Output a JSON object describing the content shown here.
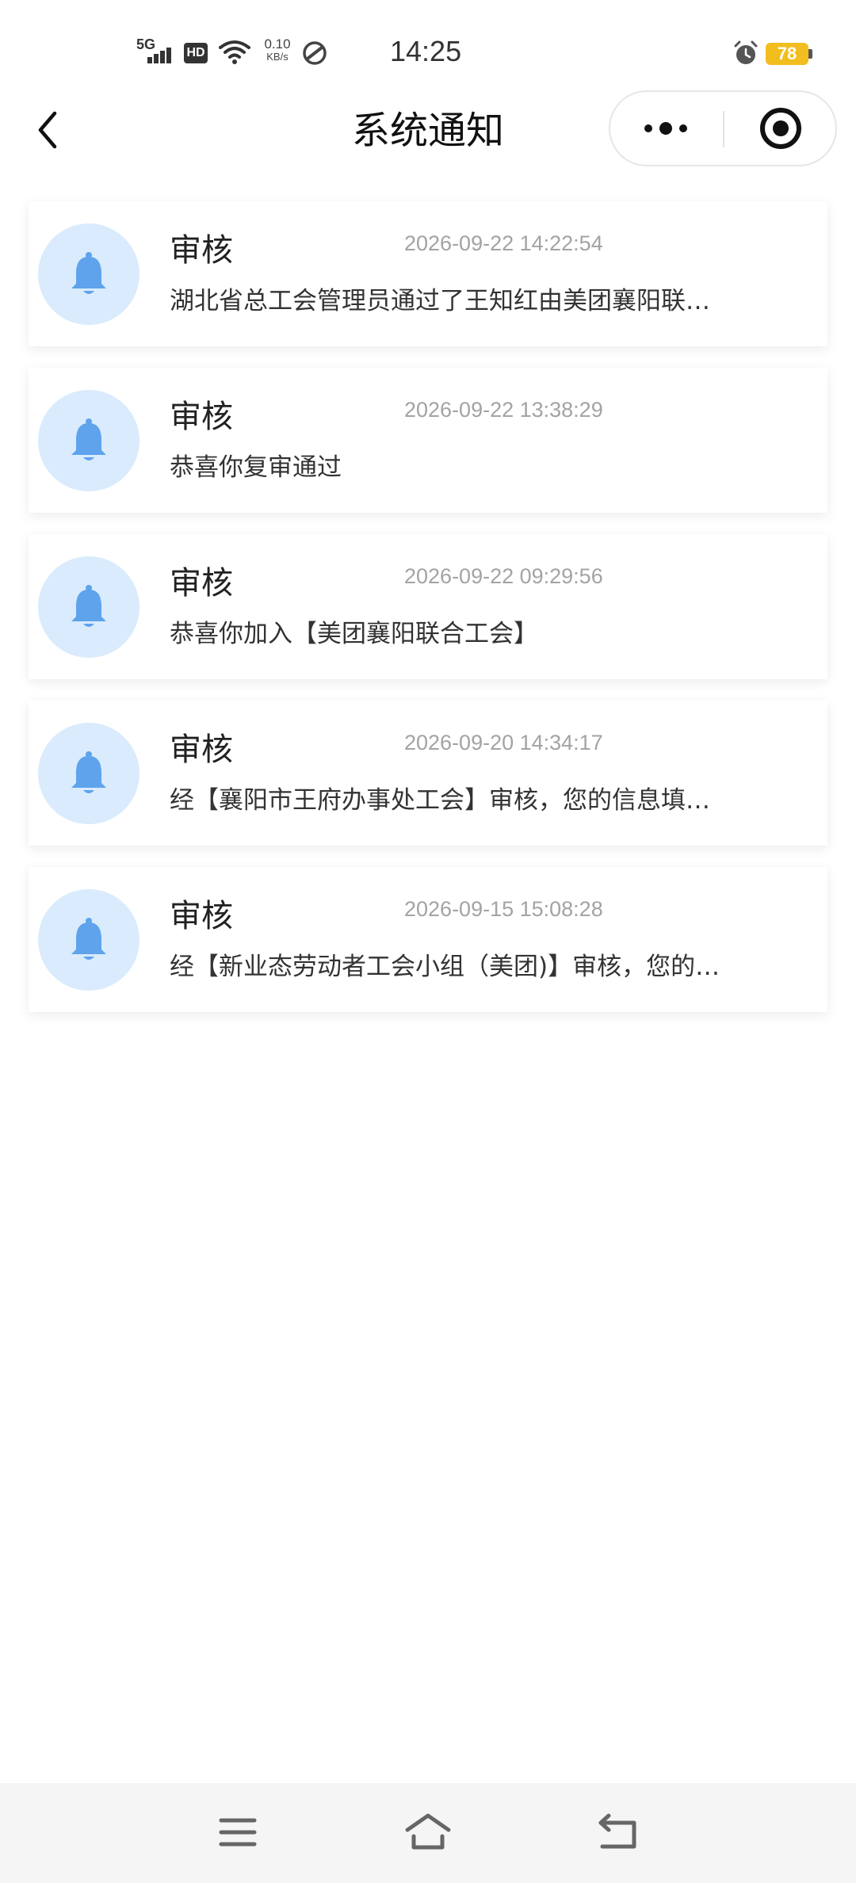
{
  "status_bar": {
    "network": "5G",
    "hd": "HD",
    "speed_value": "0.10",
    "speed_unit": "KB/s",
    "time": "14:25",
    "battery": "78",
    "icons": [
      "signal-icon",
      "hd-icon",
      "wifi-icon",
      "nfc-icon",
      "alarm-icon",
      "battery-icon"
    ]
  },
  "nav": {
    "title": "系统通知",
    "icons": {
      "back": "back-arrow-icon",
      "more": "more-dots-icon",
      "close": "target-close-icon"
    }
  },
  "notices": [
    {
      "type": "审核",
      "time": "2026-09-22 14:22:54",
      "content": "湖北省总工会管理员通过了王知红由美团襄阳联…"
    },
    {
      "type": "审核",
      "time": "2026-09-22 13:38:29",
      "content": "恭喜你复审通过"
    },
    {
      "type": "审核",
      "time": "2026-09-22 09:29:56",
      "content": "恭喜你加入【美团襄阳联合工会】"
    },
    {
      "type": "审核",
      "time": "2026-09-20 14:34:17",
      "content": "经【襄阳市王府办事处工会】审核，您的信息填…"
    },
    {
      "type": "审核",
      "time": "2026-09-15 15:08:28",
      "content": "经【新业态劳动者工会小组（美团)】审核，您的…"
    }
  ],
  "colors": {
    "bell": "#5ea3ec",
    "bell_bg": "#d9ebfd",
    "battery": "#f2bd1e",
    "time_text": "#a3a3a3"
  },
  "system_nav": {
    "icons": [
      "menu-icon",
      "home-icon",
      "back-icon"
    ]
  }
}
